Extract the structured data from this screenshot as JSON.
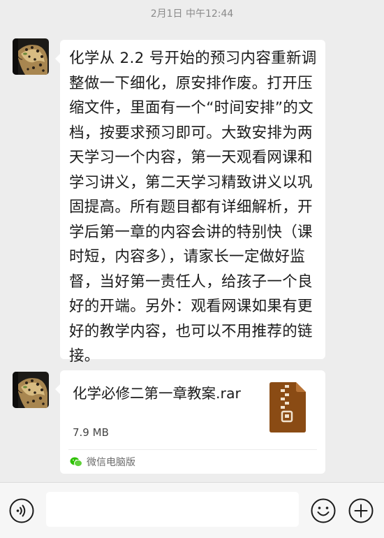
{
  "chat": {
    "timestamp": "2月1日 中午12:44",
    "messages": [
      {
        "type": "text",
        "avatar": "leopard-avatar",
        "text": "化学从 2.2 号开始的预习内容重新调整做一下细化，原安排作废。打开压缩文件，里面有一个“时间安排”的文档，按要求预习即可。大致安排为两天学习一个内容，第一天观看网课和学习讲义，第二天学习精致讲义以巩固提高。所有题目都有详细解析，开学后第一章的内容会讲的特别快（课时短，内容多），请家长一定做好监督，当好第一责任人，给孩子一个良好的开端。另外：观看网课如果有更好的教学内容，也可以不用推荐的链接。"
      },
      {
        "type": "file",
        "avatar": "leopard-avatar",
        "file_name": "化学必修二第一章教案.rar",
        "file_size": "7.9 MB",
        "file_icon": "archive-zip-icon",
        "source": "微信电脑版",
        "source_icon": "wechat-icon"
      }
    ]
  },
  "input_bar": {
    "input_value": "",
    "voice_icon": "voice-icon",
    "emoji_icon": "emoji-icon",
    "plus_icon": "plus-icon"
  },
  "colors": {
    "background": "#ededed",
    "bubble": "#ffffff",
    "archive": "#8a4b14",
    "wechat_green": "#2dc100"
  }
}
